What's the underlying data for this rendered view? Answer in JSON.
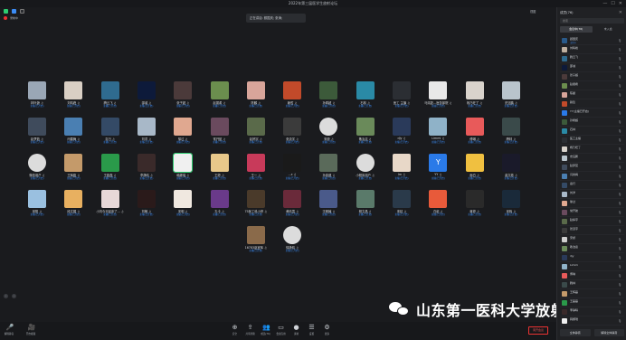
{
  "window": {
    "title": "2022年第三届医学生放射论坛",
    "speaker_text": "正在讲话: 颜国庆; 张涛;",
    "view_label": "视图",
    "controls": [
      "—",
      "☐",
      "✕"
    ]
  },
  "status": {
    "recording_label": "录制中"
  },
  "grid": {
    "rows": [
      [
        {
          "name": "林叶静 ♫",
          "sub": "主播(已开启)",
          "color": "#9aa7b6"
        },
        {
          "name": "刘晴峰 ♫",
          "sub": "主播(已开启)",
          "color": "#d9cfc4"
        },
        {
          "name": "腾云飞 ♫",
          "sub": "主播(已开启)",
          "color": "#2f6b8f"
        },
        {
          "name": "邵诚 ♫",
          "sub": "主播(已开启)",
          "color": "#0d1a3a"
        },
        {
          "name": "张子超 ♫",
          "sub": "主播(已开启)",
          "color": "#4b3a3a"
        },
        {
          "name": "赵振希 ♫",
          "sub": "主播(已开启)",
          "color": "#6b8e4e"
        },
        {
          "name": "陈麟 ♫",
          "sub": "主播(已开启)",
          "color": "#d8a59a"
        },
        {
          "name": "赖哲 ♫",
          "sub": "主播(已开启)",
          "color": "#c24a2a"
        },
        {
          "name": "孙希超 ♫",
          "sub": "主播(已开启)",
          "color": "#3c5a3a"
        },
        {
          "name": "石林 ♫",
          "sub": "主播(已开启)",
          "color": "#2a8aa6"
        },
        {
          "name": "医工 主播 ♫",
          "sub": "主播(已开启)",
          "color": "#2b2e33"
        },
        {
          "name": "马婧懿...医务部院 ♫",
          "sub": "主播(已开启)",
          "color": "#e8e8e8"
        },
        {
          "name": "杨乃旺了 ♫",
          "sub": "主播(已开启)",
          "color": "#d9d3cc"
        },
        {
          "name": "史钰鹏 ♫",
          "sub": "主播(已开启)",
          "color": "#b9c4cc"
        }
      ],
      [
        {
          "name": "赵梦茹 ♫",
          "sub": "主播(已开启)",
          "color": "#3f4b5c"
        },
        {
          "name": "闫春梅 ♫",
          "sub": "主播(已开启)",
          "color": "#4a7fb2"
        },
        {
          "name": "嘉行 ♫",
          "sub": "主播(已开启)",
          "color": "#344a66"
        },
        {
          "name": "刘洋 ♫",
          "sub": "主播(已开启)",
          "color": "#a8b8c8"
        },
        {
          "name": "徐过 ♫",
          "sub": "主播(已开启)",
          "color": "#e0a890"
        },
        {
          "name": "常开航 ♫",
          "sub": "主播(已开启)",
          "color": "#6a4a5e"
        },
        {
          "name": "赵婷宇 ♫",
          "sub": "主播(已开启)",
          "color": "#5a6a4a"
        },
        {
          "name": "张潇宇 ♫",
          "sub": "主播(已开启)",
          "color": "#3b3b3b"
        },
        {
          "name": "宋娇 ♫",
          "sub": "主播(已开启)",
          "color": "#d0d0d0",
          "placeholder": true
        },
        {
          "name": "敬治嘉 ♫",
          "sub": "主播(已开启)",
          "color": "#6a8a5a"
        },
        {
          "name": "djy ♫",
          "sub": "主播(已开启)",
          "color": "#2a3a5a"
        },
        {
          "name": "Limmi ♫",
          "sub": "主播(已开启)",
          "color": "#8fb2c8"
        },
        {
          "name": "傅琳 ♫",
          "sub": "主播(已开启)",
          "color": "#e85a5a"
        },
        {
          "name": "腾林 ♫",
          "sub": "主播(已开启)",
          "color": "#3a4a4a"
        }
      ],
      [
        {
          "name": "微信用户 ♫",
          "sub": "主播(已开启)",
          "color": "#d0d0d0",
          "placeholder": true
        },
        {
          "name": "王辉磊 ♫",
          "sub": "主播(已开启)",
          "color": "#c49a6a"
        },
        {
          "name": "王磊磊 ♫",
          "sub": "主播(已开启)",
          "color": "#2a9a4a"
        },
        {
          "name": "李静晴 ♫",
          "sub": "主播(已开启)",
          "color": "#3a2a2a"
        },
        {
          "name": "韩娜瑞 ♫",
          "sub": "主播(已开启)",
          "color": "#f0f0f0",
          "selected": true
        },
        {
          "name": "王婷 ♫",
          "sub": "主播(已开启)",
          "color": "#e8c88a"
        },
        {
          "name": "王一 ♫",
          "sub": "主播(已开启)",
          "color": "#c83a5a"
        },
        {
          "name": "…ε ♫",
          "sub": "主播(已开启)",
          "color": "#1a1a1a"
        },
        {
          "name": "孙鑫健 ♫",
          "sub": "主播(已开启)",
          "color": "#5a6a5a"
        },
        {
          "name": "小程序用户 ♫",
          "sub": "主播(已开启)",
          "color": "#d0d0d0",
          "placeholder": true
        },
        {
          "name": "Im ♫",
          "sub": "主播(已开启)",
          "color": "#e8d8c8"
        },
        {
          "name": "YY ♫",
          "sub": "主播(已开启)",
          "color": "#2a7ae8",
          "letter": "Y"
        },
        {
          "name": "面白 ♫",
          "sub": "主播(已开启)",
          "color": "#f0c040"
        },
        {
          "name": "曲文彬 ♫",
          "sub": "主播(已开启)",
          "color": "#1a1a2a"
        }
      ],
      [
        {
          "name": "张阳 ♫",
          "sub": "主播(已开启)",
          "color": "#9ac0e0"
        },
        {
          "name": "段文娟 ♫",
          "sub": "主播(已开启)",
          "color": "#e8b060"
        },
        {
          "name": "小刘今天起床了... ♫",
          "sub": "主播(已开启)",
          "color": "#e8d8d8"
        },
        {
          "name": "刘畅 ♫",
          "sub": "主播(已开启)",
          "color": "#2a1a1a"
        },
        {
          "name": "安明 ♫",
          "sub": "主播(已开启)",
          "color": "#f0e8e0"
        },
        {
          "name": "孔卡 ♫",
          "sub": "主播(已开启)",
          "color": "#6a3a8a"
        },
        {
          "name": "75医工科小婷 ♫",
          "sub": "主播(已开启)",
          "color": "#4a3a2a"
        },
        {
          "name": "黄晴霞 ♫",
          "sub": "主播(已开启)",
          "color": "#6a2a3a"
        },
        {
          "name": "汪雅楠 ♫",
          "sub": "主播(已开启)",
          "color": "#4a5a8a"
        },
        {
          "name": "程文昌 ♫",
          "sub": "主播(已开启)",
          "color": "#5a7a6a"
        },
        {
          "name": "宋婧 ♫",
          "sub": "主播(已开启)",
          "color": "#2a3a4a"
        },
        {
          "name": "白纸 ♫",
          "sub": "主播(已开启)",
          "color": "#e85a3a"
        },
        {
          "name": "蒋婷 ♫",
          "sub": "主播(已开启)",
          "color": "#2a2a2a"
        },
        {
          "name": "张辉 ♫",
          "sub": "主播(已开启)",
          "color": "#1a2a3a"
        }
      ],
      [
        {
          "name": "16783赵宜辉 ♫",
          "sub": "主播(已开启)",
          "color": "#8a6a4a"
        },
        {
          "name": "徐静晴 ♫",
          "sub": "主播(已开启)",
          "color": "#d8d8d8",
          "placeholder": true
        }
      ]
    ]
  },
  "panel": {
    "title": "成员(76)",
    "search_placeholder": "搜索",
    "tabs": [
      "会议中(76)",
      "未入会"
    ],
    "members": [
      {
        "name": "颜国庆",
        "role": "主持人",
        "color": "#2a5a8a"
      },
      {
        "name": "刘晴峰",
        "role": "",
        "color": "#c0b0a0"
      },
      {
        "name": "腾云飞",
        "role": "",
        "color": "#2f6b8f"
      },
      {
        "name": "邵诚",
        "role": "",
        "color": "#0d1a3a"
      },
      {
        "name": "张子超",
        "role": "",
        "color": "#4b3a3a"
      },
      {
        "name": "赵振希",
        "role": "",
        "color": "#6b8e4e"
      },
      {
        "name": "陈麟",
        "role": "",
        "color": "#d8a59a"
      },
      {
        "name": "赖哲",
        "role": "",
        "color": "#c24a2a"
      },
      {
        "name": "YY(主播已开启)",
        "role": "",
        "color": "#2a7ae8"
      },
      {
        "name": "孙希超",
        "role": "",
        "color": "#3c5a3a"
      },
      {
        "name": "石林",
        "role": "",
        "color": "#2a8aa6"
      },
      {
        "name": "医工主播",
        "role": "",
        "color": "#2b2e33"
      },
      {
        "name": "杨乃旺了",
        "role": "",
        "color": "#d9d3cc"
      },
      {
        "name": "史钰鹏",
        "role": "",
        "color": "#b9c4cc"
      },
      {
        "name": "赵梦茹",
        "role": "",
        "color": "#3f4b5c"
      },
      {
        "name": "闫春梅",
        "role": "",
        "color": "#4a7fb2"
      },
      {
        "name": "嘉行",
        "role": "",
        "color": "#344a66"
      },
      {
        "name": "刘洋",
        "role": "",
        "color": "#a8b8c8"
      },
      {
        "name": "徐过",
        "role": "",
        "color": "#e0a890"
      },
      {
        "name": "常开航",
        "role": "",
        "color": "#6a4a5e"
      },
      {
        "name": "赵婷宇",
        "role": "",
        "color": "#5a6a4a"
      },
      {
        "name": "张潇宇",
        "role": "",
        "color": "#3b3b3b"
      },
      {
        "name": "宋娇",
        "role": "",
        "color": "#d0d0d0"
      },
      {
        "name": "敬治嘉",
        "role": "",
        "color": "#6a8a5a"
      },
      {
        "name": "djy",
        "role": "",
        "color": "#2a3a5a"
      },
      {
        "name": "Limmi",
        "role": "",
        "color": "#8fb2c8"
      },
      {
        "name": "傅琳",
        "role": "",
        "color": "#e85a5a"
      },
      {
        "name": "腾林",
        "role": "",
        "color": "#3a4a4a"
      },
      {
        "name": "王辉磊",
        "role": "",
        "color": "#c49a6a"
      },
      {
        "name": "王磊磊",
        "role": "",
        "color": "#2a9a4a"
      },
      {
        "name": "李静晴",
        "role": "",
        "color": "#3a2a2a"
      },
      {
        "name": "韩娜瑞",
        "role": "",
        "color": "#f0f0f0"
      }
    ],
    "mute_all_label": "全体静音",
    "unmute_all_label": "解除全体静音"
  },
  "toolbar": {
    "left": [
      {
        "icon": "🎤",
        "label": "解除静音",
        "name": "unmute"
      },
      {
        "icon": "🎥",
        "label": "开启视频",
        "name": "start-video"
      }
    ],
    "center": [
      {
        "icon": "⊕",
        "label": "安全",
        "name": "security"
      },
      {
        "icon": "⇪",
        "label": "共享屏幕",
        "name": "share-screen"
      },
      {
        "icon": "👥",
        "label": "成员(76)",
        "name": "participants"
      },
      {
        "icon": "▭",
        "label": "会议应用",
        "name": "apps"
      },
      {
        "icon": "●",
        "label": "录制",
        "name": "record"
      },
      {
        "icon": "☰",
        "label": "设置",
        "name": "settings"
      },
      {
        "icon": "⚙",
        "label": "更多",
        "name": "more"
      }
    ],
    "leave_label": "离开会议"
  },
  "watermark": {
    "text": "山东第一医科大学放射学院"
  }
}
